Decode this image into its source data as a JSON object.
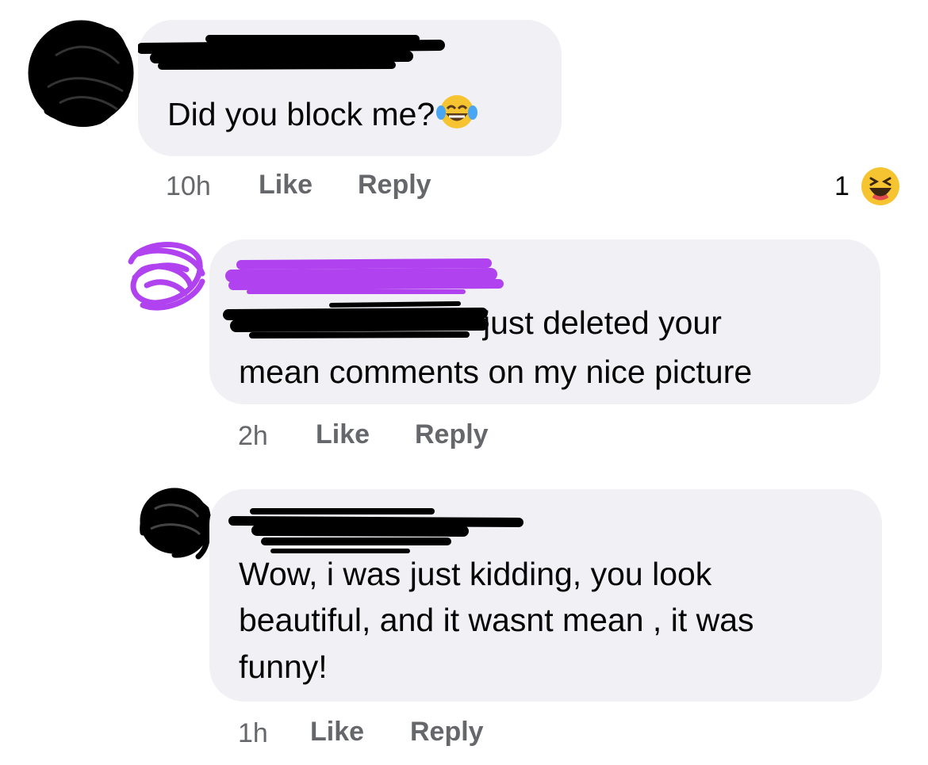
{
  "comments": [
    {
      "text": "Did you block me?",
      "emoji": "tears-of-joy-emoji",
      "time": "10h",
      "like_label": "Like",
      "reply_label": "Reply",
      "reaction_count": "1",
      "reaction_icon": "laughing-squint-emoji"
    },
    {
      "text_line1": "just deleted your",
      "text_line2": "mean comments on my nice picture",
      "time": "2h",
      "like_label": "Like",
      "reply_label": "Reply",
      "redaction_color": "#b043ef"
    },
    {
      "text_line1": "Wow, i was just kidding, you look",
      "text_line2": "beautiful, and it wasnt mean , it was",
      "text_line3": "funny!",
      "time": "1h",
      "like_label": "Like",
      "reply_label": "Reply"
    }
  ]
}
